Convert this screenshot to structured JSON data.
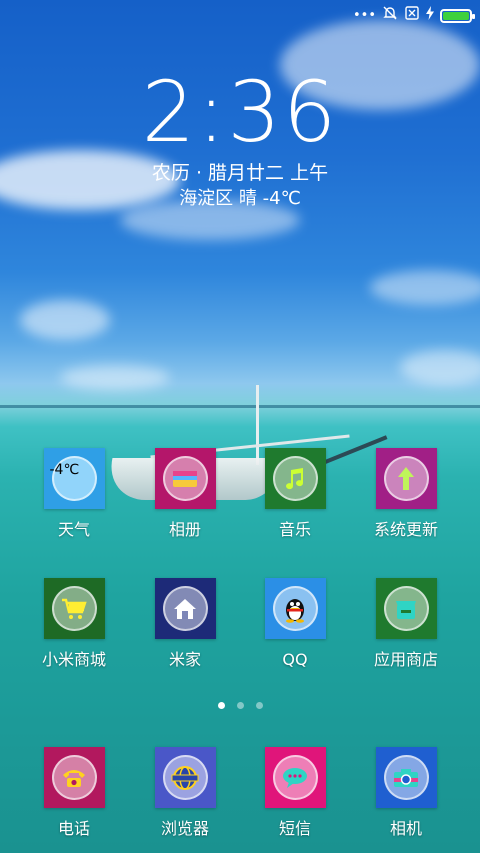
{
  "status_bar": {
    "icons": [
      "more-dots-icon",
      "alarm-off-icon",
      "no-sim-icon",
      "charging-bolt-icon",
      "battery-icon"
    ],
    "battery_level": 1.0,
    "battery_color": "#3ed13e"
  },
  "clock": {
    "time": "2:36",
    "lunar_date": "农历 · 腊月廿二  上午",
    "weather": "海淀区  晴  -4℃"
  },
  "weather_widget_text": "-4℃",
  "apps": {
    "row1": [
      {
        "label": "天气",
        "icon": "weather-icon",
        "color": "#2f9fe6"
      },
      {
        "label": "相册",
        "icon": "gallery-icon",
        "color": "#b4166a"
      },
      {
        "label": "音乐",
        "icon": "music-note-icon",
        "color": "#1f7a2e"
      },
      {
        "label": "系统更新",
        "icon": "system-update-icon",
        "color": "#a11f86"
      }
    ],
    "row2": [
      {
        "label": "小米商城",
        "icon": "shopping-cart-icon",
        "color": "#1e6a25"
      },
      {
        "label": "米家",
        "icon": "home-icon",
        "color": "#1d2a78"
      },
      {
        "label": "QQ",
        "icon": "qq-penguin-icon",
        "color": "#2b8fe6"
      },
      {
        "label": "应用商店",
        "icon": "app-store-icon",
        "color": "#1f7a2e"
      }
    ],
    "dock": [
      {
        "label": "电话",
        "icon": "phone-icon",
        "color": "#b2185e"
      },
      {
        "label": "浏览器",
        "icon": "browser-globe-icon",
        "color": "#4a57c8"
      },
      {
        "label": "短信",
        "icon": "message-icon",
        "color": "#e0157a"
      },
      {
        "label": "相机",
        "icon": "camera-icon",
        "color": "#1f5fd0"
      }
    ]
  },
  "page_indicator": {
    "pages": 3,
    "active": 1
  }
}
